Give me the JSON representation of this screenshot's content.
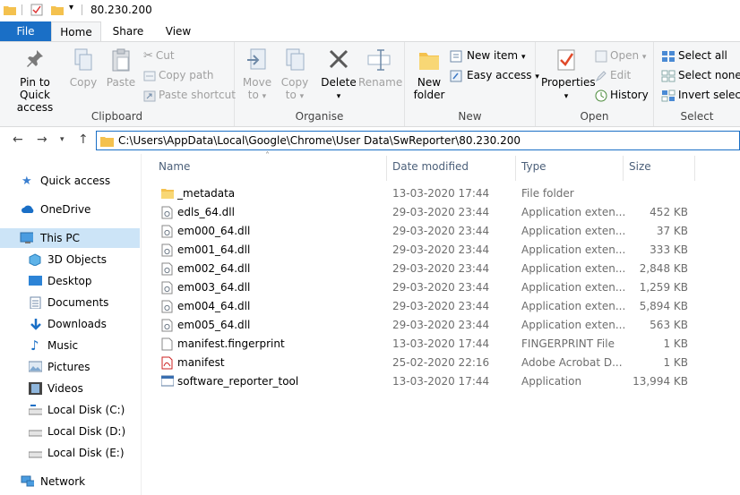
{
  "window": {
    "title": "80.230.200"
  },
  "tabs": [
    {
      "label": "File"
    },
    {
      "label": "Home"
    },
    {
      "label": "Share"
    },
    {
      "label": "View"
    }
  ],
  "ribbon": {
    "clipboard": {
      "label": "Clipboard",
      "pin": "Pin to Quick access",
      "pin_line1": "Pin to Quick",
      "pin_line2": "access",
      "copy": "Copy",
      "paste": "Paste",
      "cut": "Cut",
      "copy_path": "Copy path",
      "paste_shortcut": "Paste shortcut"
    },
    "organise": {
      "label": "Organise",
      "move_to_1": "Move",
      "move_to_2": "to",
      "copy_to_1": "Copy",
      "copy_to_2": "to",
      "delete": "Delete",
      "rename": "Rename"
    },
    "new": {
      "label": "New",
      "new_folder_1": "New",
      "new_folder_2": "folder",
      "new_item": "New item",
      "easy_access": "Easy access"
    },
    "open": {
      "label": "Open",
      "properties": "Properties",
      "open": "Open",
      "edit": "Edit",
      "history": "History"
    },
    "select": {
      "label": "Select",
      "select_all": "Select all",
      "select_none": "Select none",
      "invert": "Invert selectio"
    }
  },
  "address": {
    "path": "C:\\Users\\AppData\\Local\\Google\\Chrome\\User Data\\SwReporter\\80.230.200"
  },
  "nav": [
    {
      "label": "Quick access",
      "icon": "star-icon"
    },
    {
      "label": "OneDrive",
      "icon": "cloud-icon"
    },
    {
      "label": "This PC",
      "icon": "computer-icon",
      "selected": true
    },
    {
      "label": "3D Objects",
      "icon": "cube-icon"
    },
    {
      "label": "Desktop",
      "icon": "desktop-icon"
    },
    {
      "label": "Documents",
      "icon": "documents-icon"
    },
    {
      "label": "Downloads",
      "icon": "download-icon"
    },
    {
      "label": "Music",
      "icon": "music-icon"
    },
    {
      "label": "Pictures",
      "icon": "pictures-icon"
    },
    {
      "label": "Videos",
      "icon": "videos-icon"
    },
    {
      "label": "Local Disk (C:)",
      "icon": "drive-icon"
    },
    {
      "label": "Local Disk (D:)",
      "icon": "drive-icon"
    },
    {
      "label": "Local Disk (E:)",
      "icon": "drive-icon"
    },
    {
      "label": "Network",
      "icon": "network-icon"
    }
  ],
  "columns": {
    "name": "Name",
    "date": "Date modified",
    "type": "Type",
    "size": "Size"
  },
  "files": [
    {
      "name": "_metadata",
      "date": "13-03-2020 17:44",
      "type": "File folder",
      "size": "",
      "icon": "folder-icon"
    },
    {
      "name": "edls_64.dll",
      "date": "29-03-2020 23:44",
      "type": "Application exten...",
      "size": "452 KB",
      "icon": "dll-icon"
    },
    {
      "name": "em000_64.dll",
      "date": "29-03-2020 23:44",
      "type": "Application exten...",
      "size": "37 KB",
      "icon": "dll-icon"
    },
    {
      "name": "em001_64.dll",
      "date": "29-03-2020 23:44",
      "type": "Application exten...",
      "size": "333 KB",
      "icon": "dll-icon"
    },
    {
      "name": "em002_64.dll",
      "date": "29-03-2020 23:44",
      "type": "Application exten...",
      "size": "2,848 KB",
      "icon": "dll-icon"
    },
    {
      "name": "em003_64.dll",
      "date": "29-03-2020 23:44",
      "type": "Application exten...",
      "size": "1,259 KB",
      "icon": "dll-icon"
    },
    {
      "name": "em004_64.dll",
      "date": "29-03-2020 23:44",
      "type": "Application exten...",
      "size": "5,894 KB",
      "icon": "dll-icon"
    },
    {
      "name": "em005_64.dll",
      "date": "29-03-2020 23:44",
      "type": "Application exten...",
      "size": "563 KB",
      "icon": "dll-icon"
    },
    {
      "name": "manifest.fingerprint",
      "date": "13-03-2020 17:44",
      "type": "FINGERPRINT File",
      "size": "1 KB",
      "icon": "file-icon"
    },
    {
      "name": "manifest",
      "date": "25-02-2020 22:16",
      "type": "Adobe Acrobat D...",
      "size": "1 KB",
      "icon": "pdf-icon"
    },
    {
      "name": "software_reporter_tool",
      "date": "13-03-2020 17:44",
      "type": "Application",
      "size": "13,994 KB",
      "icon": "exe-icon"
    }
  ]
}
